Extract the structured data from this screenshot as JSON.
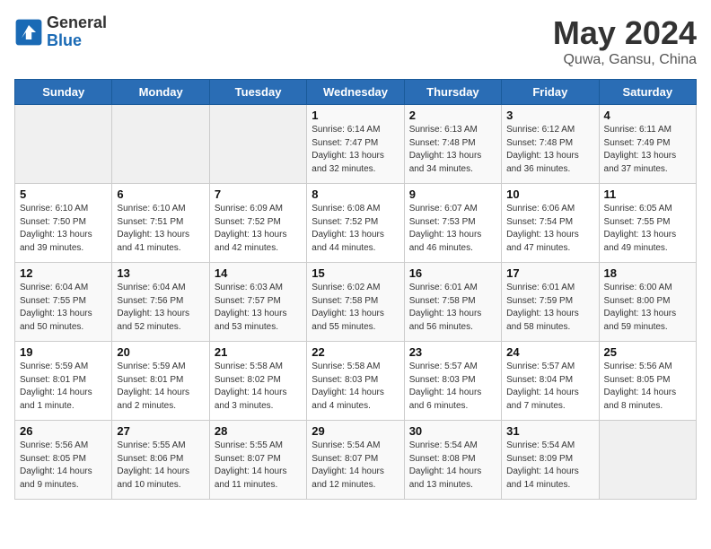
{
  "header": {
    "logo": {
      "general": "General",
      "blue": "Blue"
    },
    "title": "May 2024",
    "subtitle": "Quwa, Gansu, China"
  },
  "weekdays": [
    "Sunday",
    "Monday",
    "Tuesday",
    "Wednesday",
    "Thursday",
    "Friday",
    "Saturday"
  ],
  "weeks": [
    [
      {
        "day": "",
        "info": ""
      },
      {
        "day": "",
        "info": ""
      },
      {
        "day": "",
        "info": ""
      },
      {
        "day": "1",
        "info": "Sunrise: 6:14 AM\nSunset: 7:47 PM\nDaylight: 13 hours\nand 32 minutes."
      },
      {
        "day": "2",
        "info": "Sunrise: 6:13 AM\nSunset: 7:48 PM\nDaylight: 13 hours\nand 34 minutes."
      },
      {
        "day": "3",
        "info": "Sunrise: 6:12 AM\nSunset: 7:48 PM\nDaylight: 13 hours\nand 36 minutes."
      },
      {
        "day": "4",
        "info": "Sunrise: 6:11 AM\nSunset: 7:49 PM\nDaylight: 13 hours\nand 37 minutes."
      }
    ],
    [
      {
        "day": "5",
        "info": "Sunrise: 6:10 AM\nSunset: 7:50 PM\nDaylight: 13 hours\nand 39 minutes."
      },
      {
        "day": "6",
        "info": "Sunrise: 6:10 AM\nSunset: 7:51 PM\nDaylight: 13 hours\nand 41 minutes."
      },
      {
        "day": "7",
        "info": "Sunrise: 6:09 AM\nSunset: 7:52 PM\nDaylight: 13 hours\nand 42 minutes."
      },
      {
        "day": "8",
        "info": "Sunrise: 6:08 AM\nSunset: 7:52 PM\nDaylight: 13 hours\nand 44 minutes."
      },
      {
        "day": "9",
        "info": "Sunrise: 6:07 AM\nSunset: 7:53 PM\nDaylight: 13 hours\nand 46 minutes."
      },
      {
        "day": "10",
        "info": "Sunrise: 6:06 AM\nSunset: 7:54 PM\nDaylight: 13 hours\nand 47 minutes."
      },
      {
        "day": "11",
        "info": "Sunrise: 6:05 AM\nSunset: 7:55 PM\nDaylight: 13 hours\nand 49 minutes."
      }
    ],
    [
      {
        "day": "12",
        "info": "Sunrise: 6:04 AM\nSunset: 7:55 PM\nDaylight: 13 hours\nand 50 minutes."
      },
      {
        "day": "13",
        "info": "Sunrise: 6:04 AM\nSunset: 7:56 PM\nDaylight: 13 hours\nand 52 minutes."
      },
      {
        "day": "14",
        "info": "Sunrise: 6:03 AM\nSunset: 7:57 PM\nDaylight: 13 hours\nand 53 minutes."
      },
      {
        "day": "15",
        "info": "Sunrise: 6:02 AM\nSunset: 7:58 PM\nDaylight: 13 hours\nand 55 minutes."
      },
      {
        "day": "16",
        "info": "Sunrise: 6:01 AM\nSunset: 7:58 PM\nDaylight: 13 hours\nand 56 minutes."
      },
      {
        "day": "17",
        "info": "Sunrise: 6:01 AM\nSunset: 7:59 PM\nDaylight: 13 hours\nand 58 minutes."
      },
      {
        "day": "18",
        "info": "Sunrise: 6:00 AM\nSunset: 8:00 PM\nDaylight: 13 hours\nand 59 minutes."
      }
    ],
    [
      {
        "day": "19",
        "info": "Sunrise: 5:59 AM\nSunset: 8:01 PM\nDaylight: 14 hours\nand 1 minute."
      },
      {
        "day": "20",
        "info": "Sunrise: 5:59 AM\nSunset: 8:01 PM\nDaylight: 14 hours\nand 2 minutes."
      },
      {
        "day": "21",
        "info": "Sunrise: 5:58 AM\nSunset: 8:02 PM\nDaylight: 14 hours\nand 3 minutes."
      },
      {
        "day": "22",
        "info": "Sunrise: 5:58 AM\nSunset: 8:03 PM\nDaylight: 14 hours\nand 4 minutes."
      },
      {
        "day": "23",
        "info": "Sunrise: 5:57 AM\nSunset: 8:03 PM\nDaylight: 14 hours\nand 6 minutes."
      },
      {
        "day": "24",
        "info": "Sunrise: 5:57 AM\nSunset: 8:04 PM\nDaylight: 14 hours\nand 7 minutes."
      },
      {
        "day": "25",
        "info": "Sunrise: 5:56 AM\nSunset: 8:05 PM\nDaylight: 14 hours\nand 8 minutes."
      }
    ],
    [
      {
        "day": "26",
        "info": "Sunrise: 5:56 AM\nSunset: 8:05 PM\nDaylight: 14 hours\nand 9 minutes."
      },
      {
        "day": "27",
        "info": "Sunrise: 5:55 AM\nSunset: 8:06 PM\nDaylight: 14 hours\nand 10 minutes."
      },
      {
        "day": "28",
        "info": "Sunrise: 5:55 AM\nSunset: 8:07 PM\nDaylight: 14 hours\nand 11 minutes."
      },
      {
        "day": "29",
        "info": "Sunrise: 5:54 AM\nSunset: 8:07 PM\nDaylight: 14 hours\nand 12 minutes."
      },
      {
        "day": "30",
        "info": "Sunrise: 5:54 AM\nSunset: 8:08 PM\nDaylight: 14 hours\nand 13 minutes."
      },
      {
        "day": "31",
        "info": "Sunrise: 5:54 AM\nSunset: 8:09 PM\nDaylight: 14 hours\nand 14 minutes."
      },
      {
        "day": "",
        "info": ""
      }
    ]
  ]
}
